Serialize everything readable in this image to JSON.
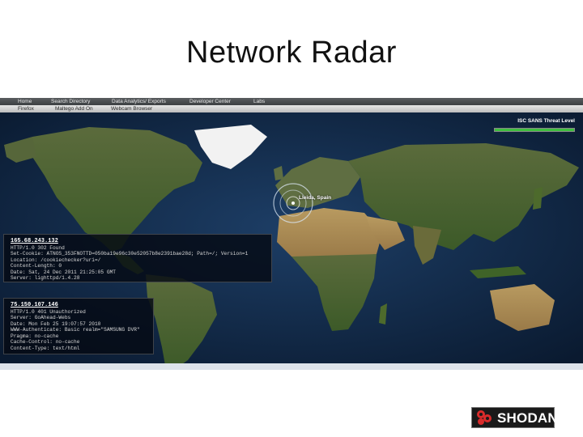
{
  "slide": {
    "title": "Network Radar"
  },
  "nav": {
    "top": [
      "Home",
      "Search Directory",
      "Data Analytics/ Exports",
      "Developer Center",
      "Labs"
    ],
    "sub": [
      "Firefox",
      "Maltego Add On",
      "Webcam Browser"
    ]
  },
  "threat_level": {
    "label": "ISC SANS Threat Level",
    "color": "#3fbf3f",
    "level": 1.0
  },
  "location": {
    "label": "Lleida, Spain"
  },
  "banners": [
    {
      "ip": "165.68.243.132",
      "lines": [
        "HTTP/1.0 302 Found",
        "Set-Cookie: ATNOS_353FNOTTD=050ba19e96c30e52057b8e2391bae28d; Path=/; Version=1",
        "Location: /cookiechecker?uri=/",
        "Content-Length: 0",
        "Date: Sat, 24 Dec 2011 21:25:05 GMT",
        "Server: lighttpd/1.4.28"
      ]
    },
    {
      "ip": "75.150.107.146",
      "lines": [
        "HTTP/1.0 401 Unauthorized",
        "Server: GoAhead-Webs",
        "Date: Mon Feb 25 19:07:57 2010",
        "WWW-Authenticate: Basic realm=\"SAMSUNG DVR\"",
        "Pragma: no-cache",
        "Cache-Control: no-cache",
        "Content-Type: text/html"
      ]
    }
  ],
  "logo": {
    "text": "SHODAN",
    "colors": {
      "dot": "#d92b2b",
      "background": "#1a1a1a"
    }
  }
}
